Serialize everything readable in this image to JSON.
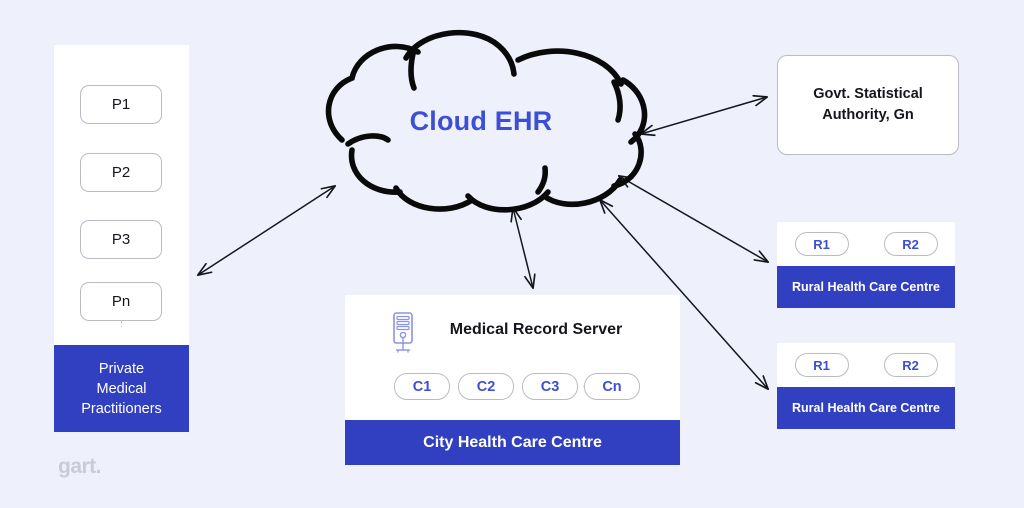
{
  "diagram": {
    "title": "Cloud EHR",
    "background_color": "#eef1fb",
    "accent_blue": "#3040c0",
    "text_blue": "#3d4fd4"
  },
  "cloud": {
    "label": "Cloud EHR"
  },
  "private_practitioners": {
    "band_label": "Private\nMedical\nPractitioners",
    "band_line1": "Private",
    "band_line2": "Medical",
    "band_line3": "Practitioners",
    "nodes": [
      {
        "label": "P1"
      },
      {
        "label": "P2"
      },
      {
        "label": "P3"
      },
      {
        "label": "Pn"
      }
    ]
  },
  "govt_authority": {
    "line1": "Govt. Statistical",
    "line2": "Authority, Gn"
  },
  "rural_centres": [
    {
      "band_label": "Rural Health Care Centre",
      "nodes": [
        {
          "label": "R1"
        },
        {
          "label": "R2"
        }
      ]
    },
    {
      "band_label": "Rural Health Care Centre",
      "nodes": [
        {
          "label": "R1"
        },
        {
          "label": "R2"
        }
      ]
    }
  ],
  "city_centre": {
    "server_title": "Medical Record Server",
    "server_icon": "server-tower-icon",
    "band_label": "City Health Care Centre",
    "nodes": [
      {
        "label": "C1"
      },
      {
        "label": "C2"
      },
      {
        "label": "C3"
      },
      {
        "label": "Cn"
      }
    ]
  },
  "connections": [
    {
      "from": "private-medical-practitioners",
      "to": "cloud-ehr",
      "style": "double-arrow"
    },
    {
      "from": "cloud-ehr",
      "to": "govt-statistical-authority",
      "style": "double-arrow"
    },
    {
      "from": "cloud-ehr",
      "to": "rural-health-care-centre-1",
      "style": "double-arrow"
    },
    {
      "from": "cloud-ehr",
      "to": "rural-health-care-centre-2",
      "style": "double-arrow"
    },
    {
      "from": "cloud-ehr",
      "to": "medical-record-server",
      "style": "double-arrow"
    }
  ],
  "logo": {
    "text": "gart."
  }
}
